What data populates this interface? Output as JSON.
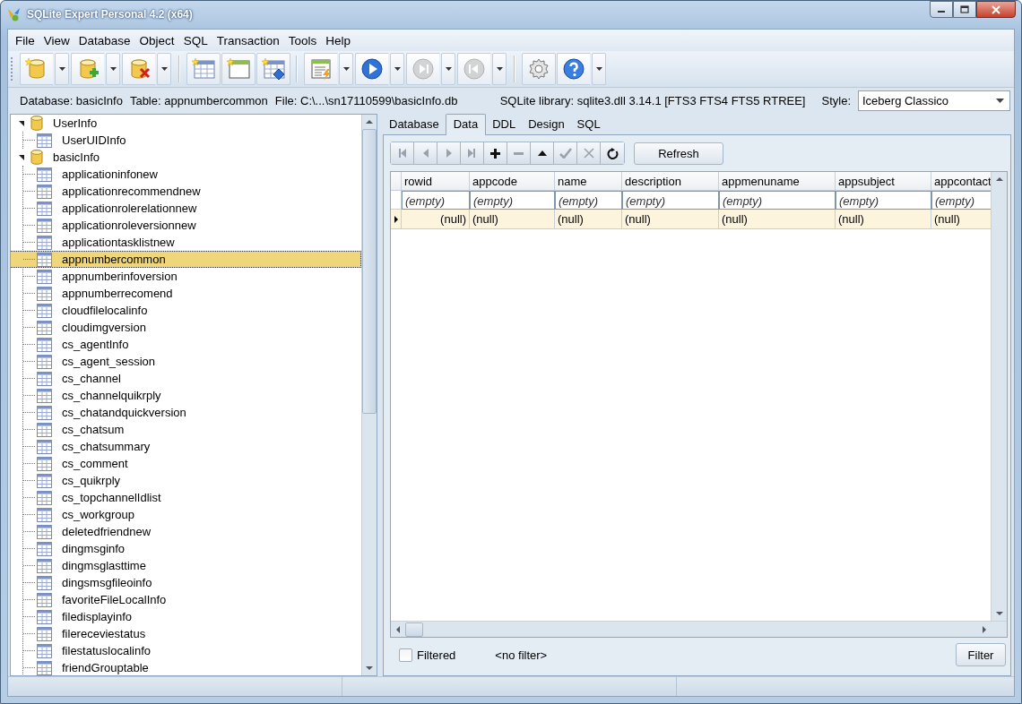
{
  "window": {
    "title": "SQLite Expert Personal 4.2 (x64)"
  },
  "menu": [
    "File",
    "View",
    "Database",
    "Object",
    "SQL",
    "Transaction",
    "Tools",
    "Help"
  ],
  "toolbar": [
    {
      "kind": "new-database",
      "dropdown": true,
      "disabled": false
    },
    {
      "kind": "attach-database",
      "dropdown": true,
      "disabled": false
    },
    {
      "kind": "detach-database",
      "dropdown": true,
      "disabled": false
    },
    {
      "kind": "separator"
    },
    {
      "kind": "new-table",
      "dropdown": false,
      "disabled": false
    },
    {
      "kind": "new-view",
      "dropdown": false,
      "disabled": false
    },
    {
      "kind": "new-index",
      "dropdown": false,
      "disabled": false
    },
    {
      "kind": "separator"
    },
    {
      "kind": "sql-script",
      "dropdown": true,
      "disabled": false
    },
    {
      "kind": "run",
      "dropdown": true,
      "disabled": false
    },
    {
      "kind": "step",
      "dropdown": true,
      "disabled": true
    },
    {
      "kind": "back",
      "dropdown": true,
      "disabled": true
    },
    {
      "kind": "separator"
    },
    {
      "kind": "settings",
      "dropdown": false,
      "disabled": false
    },
    {
      "kind": "help",
      "dropdown": true,
      "disabled": false
    }
  ],
  "info_bar": {
    "database": "Database: basicInfo",
    "table": "Table: appnumbercommon",
    "file": "File: C:\\...\\sn17110599\\basicInfo.db",
    "library": "SQLite library: sqlite3.dll 3.14.1 [FTS3 FTS4 FTS5 RTREE]",
    "style_label": "Style:",
    "style_value": "Iceberg Classico"
  },
  "tree": [
    {
      "kind": "database",
      "label": "UserInfo",
      "expanded": true,
      "selected": false,
      "children": [
        {
          "kind": "table",
          "label": "UserUIDInfo",
          "selected": false
        }
      ]
    },
    {
      "kind": "database",
      "label": "basicInfo",
      "expanded": true,
      "selected": false,
      "children": [
        {
          "kind": "table",
          "label": "applicationinfonew",
          "selected": false
        },
        {
          "kind": "table",
          "label": "applicationrecommendnew",
          "selected": false
        },
        {
          "kind": "table",
          "label": "applicationrolerelationnew",
          "selected": false
        },
        {
          "kind": "table",
          "label": "applicationroleversionnew",
          "selected": false
        },
        {
          "kind": "table",
          "label": "applicationtasklistnew",
          "selected": false
        },
        {
          "kind": "table",
          "label": "appnumbercommon",
          "selected": true
        },
        {
          "kind": "table",
          "label": "appnumberinfoversion",
          "selected": false
        },
        {
          "kind": "table",
          "label": "appnumberrecomend",
          "selected": false
        },
        {
          "kind": "table",
          "label": "cloudfilelocalinfo",
          "selected": false
        },
        {
          "kind": "table",
          "label": "cloudimgversion",
          "selected": false
        },
        {
          "kind": "table",
          "label": "cs_agentInfo",
          "selected": false
        },
        {
          "kind": "table",
          "label": "cs_agent_session",
          "selected": false
        },
        {
          "kind": "table",
          "label": "cs_channel",
          "selected": false
        },
        {
          "kind": "table",
          "label": "cs_channelquikrply",
          "selected": false
        },
        {
          "kind": "table",
          "label": "cs_chatandquickversion",
          "selected": false
        },
        {
          "kind": "table",
          "label": "cs_chatsum",
          "selected": false
        },
        {
          "kind": "table",
          "label": "cs_chatsummary",
          "selected": false
        },
        {
          "kind": "table",
          "label": "cs_comment",
          "selected": false
        },
        {
          "kind": "table",
          "label": "cs_quikrply",
          "selected": false
        },
        {
          "kind": "table",
          "label": "cs_topchannelIdlist",
          "selected": false
        },
        {
          "kind": "table",
          "label": "cs_workgroup",
          "selected": false
        },
        {
          "kind": "table",
          "label": "deletedfriendnew",
          "selected": false
        },
        {
          "kind": "table",
          "label": "dingmsginfo",
          "selected": false
        },
        {
          "kind": "table",
          "label": "dingmsglasttime",
          "selected": false
        },
        {
          "kind": "table",
          "label": "dingsmsgfileoinfo",
          "selected": false
        },
        {
          "kind": "table",
          "label": "favoriteFileLocalInfo",
          "selected": false
        },
        {
          "kind": "table",
          "label": "filedisplayinfo",
          "selected": false
        },
        {
          "kind": "table",
          "label": "filereceviestatus",
          "selected": false
        },
        {
          "kind": "table",
          "label": "filestatuslocalinfo",
          "selected": false
        },
        {
          "kind": "table",
          "label": "friendGrouptable",
          "selected": false
        }
      ]
    }
  ],
  "tabs": [
    {
      "label": "Database",
      "selected": false
    },
    {
      "label": "Data",
      "selected": true
    },
    {
      "label": "DDL",
      "selected": false
    },
    {
      "label": "Design",
      "selected": false
    },
    {
      "label": "SQL",
      "selected": false
    }
  ],
  "navigator": [
    {
      "kind": "first",
      "disabled": true
    },
    {
      "kind": "prior",
      "disabled": true
    },
    {
      "kind": "next",
      "disabled": true
    },
    {
      "kind": "last",
      "disabled": true
    },
    {
      "kind": "insert",
      "disabled": false
    },
    {
      "kind": "delete",
      "disabled": true
    },
    {
      "kind": "edit",
      "disabled": false
    },
    {
      "kind": "post",
      "disabled": true
    },
    {
      "kind": "cancel",
      "disabled": true
    },
    {
      "kind": "refresh",
      "disabled": false
    }
  ],
  "refresh_button": "Refresh",
  "grid": {
    "columns": [
      "rowid",
      "appcode",
      "name",
      "description",
      "appmenuname",
      "appsubject",
      "appcontact"
    ],
    "filter_row": [
      "(empty)",
      "(empty)",
      "(empty)",
      "(empty)",
      "(empty)",
      "(empty)",
      "(empty)"
    ],
    "rows": [
      {
        "selected": true,
        "cells": [
          "(null)",
          "(null)",
          "(null)",
          "(null)",
          "(null)",
          "(null)",
          "(null)"
        ]
      }
    ]
  },
  "filter": {
    "label": "Filtered",
    "checked": false,
    "text": "<no filter>",
    "button": "Filter"
  }
}
